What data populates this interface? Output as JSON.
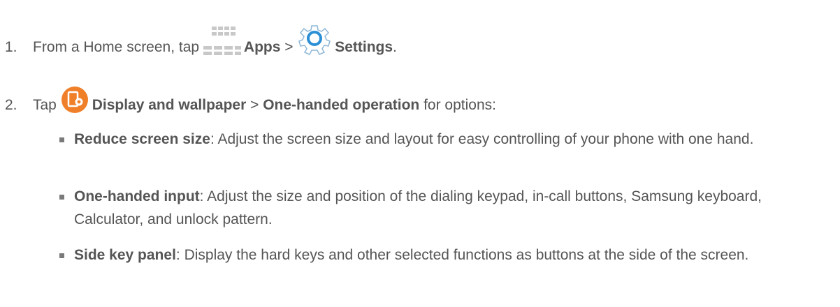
{
  "steps": [
    {
      "number": "1.",
      "prefix": "From a Home screen, tap ",
      "apps_label": "Apps",
      "sep": " > ",
      "settings_label": "Settings",
      "suffix": ".",
      "icons": [
        "apps-grid-icon",
        "settings-gear-icon"
      ]
    },
    {
      "number": "2.",
      "prefix": "Tap ",
      "display_label": "Display and wallpaper",
      "sep": " > ",
      "onehanded_label": "One-handed operation",
      "suffix": " for options:",
      "icons": [
        "display-wallpaper-icon"
      ]
    }
  ],
  "options": [
    {
      "title": "Reduce screen size",
      "text": ": Adjust the screen size and layout for easy controlling of your phone with one hand."
    },
    {
      "title": "One-handed input",
      "text": ": Adjust the size and position of the dialing keypad, in-call buttons, Samsung keyboard, Calculator, and unlock pattern."
    },
    {
      "title": "Side key panel",
      "text": ": Display the hard keys and other selected functions as buttons at the side of the screen."
    }
  ],
  "colors": {
    "text": "#555555",
    "accent_orange": "#f07f2a",
    "gear_blue": "#2b8fd6",
    "grid_gray": "#c8c8c8"
  }
}
